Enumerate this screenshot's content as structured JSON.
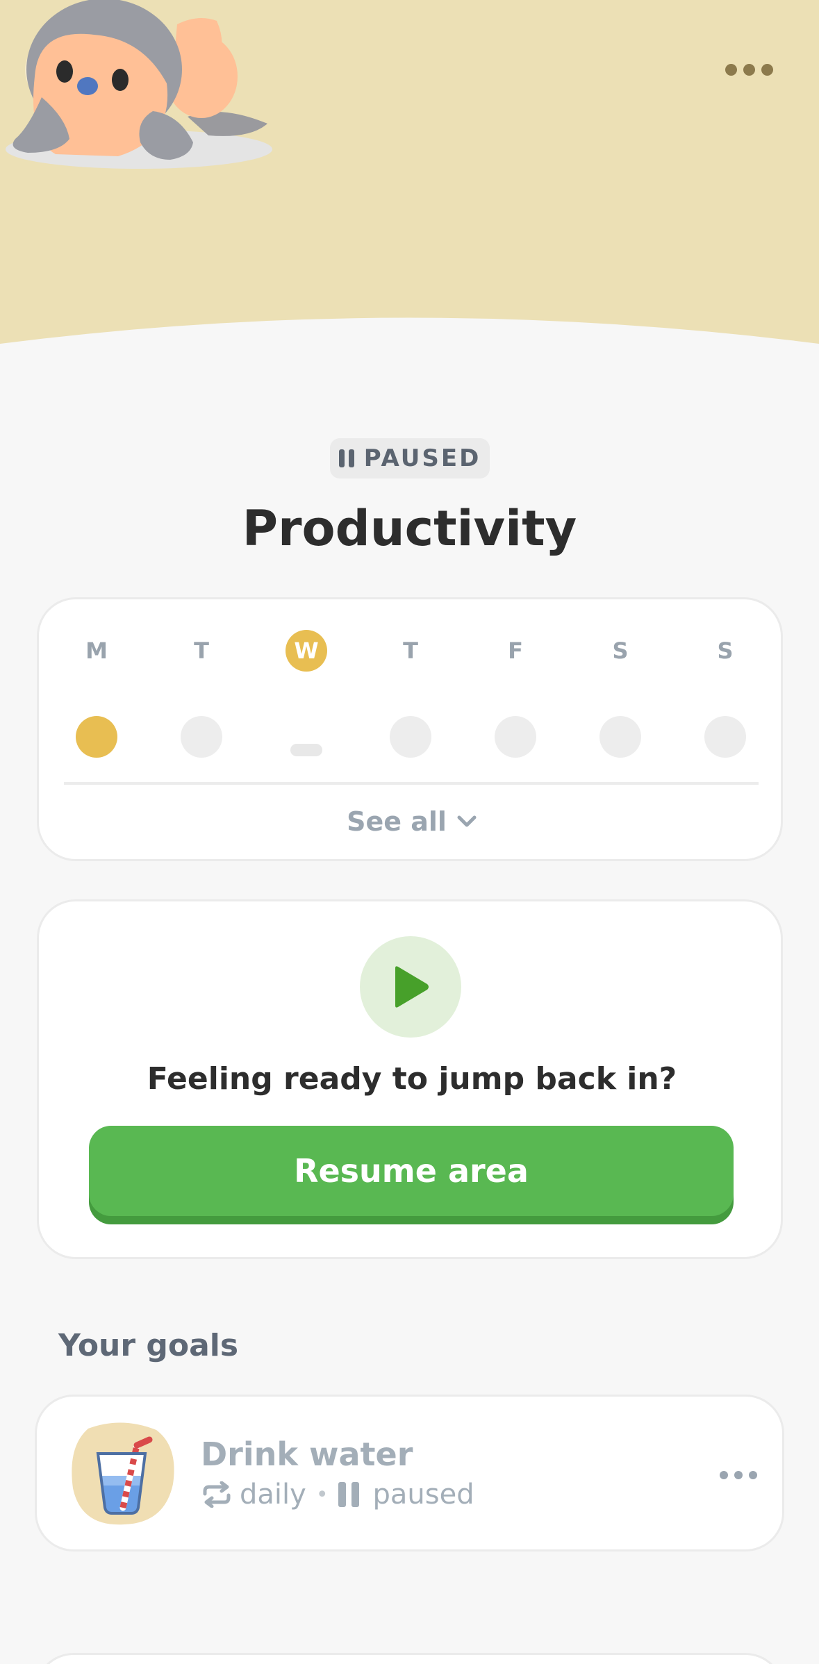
{
  "header": {
    "back_icon": "chevron-left-icon",
    "more_icon": "more-horizontal-icon",
    "background_color": "#ece0b5",
    "mascot": "penguin-mascot-illustration"
  },
  "status": {
    "label": "PAUSED",
    "icon": "pause-icon"
  },
  "area": {
    "title": "Productivity"
  },
  "week": {
    "days": [
      {
        "label": "M",
        "today": false,
        "state": "done"
      },
      {
        "label": "T",
        "today": false,
        "state": "empty"
      },
      {
        "label": "W",
        "today": true,
        "state": "dash"
      },
      {
        "label": "T",
        "today": false,
        "state": "empty"
      },
      {
        "label": "F",
        "today": false,
        "state": "empty"
      },
      {
        "label": "S",
        "today": false,
        "state": "empty"
      },
      {
        "label": "S",
        "today": false,
        "state": "empty"
      }
    ],
    "see_all_label": "See all",
    "accent_color": "#e8be52"
  },
  "resume": {
    "icon": "play-icon",
    "question": "Feeling ready to jump back in?",
    "button_label": "Resume area",
    "button_color": "#59b852"
  },
  "goals": {
    "section_title": "Your goals",
    "items": [
      {
        "name": "Drink water",
        "icon": "water-glass-icon",
        "frequency_icon": "repeat-icon",
        "frequency": "daily",
        "separator": "•",
        "status_icon": "pause-icon",
        "status": "paused"
      }
    ]
  }
}
